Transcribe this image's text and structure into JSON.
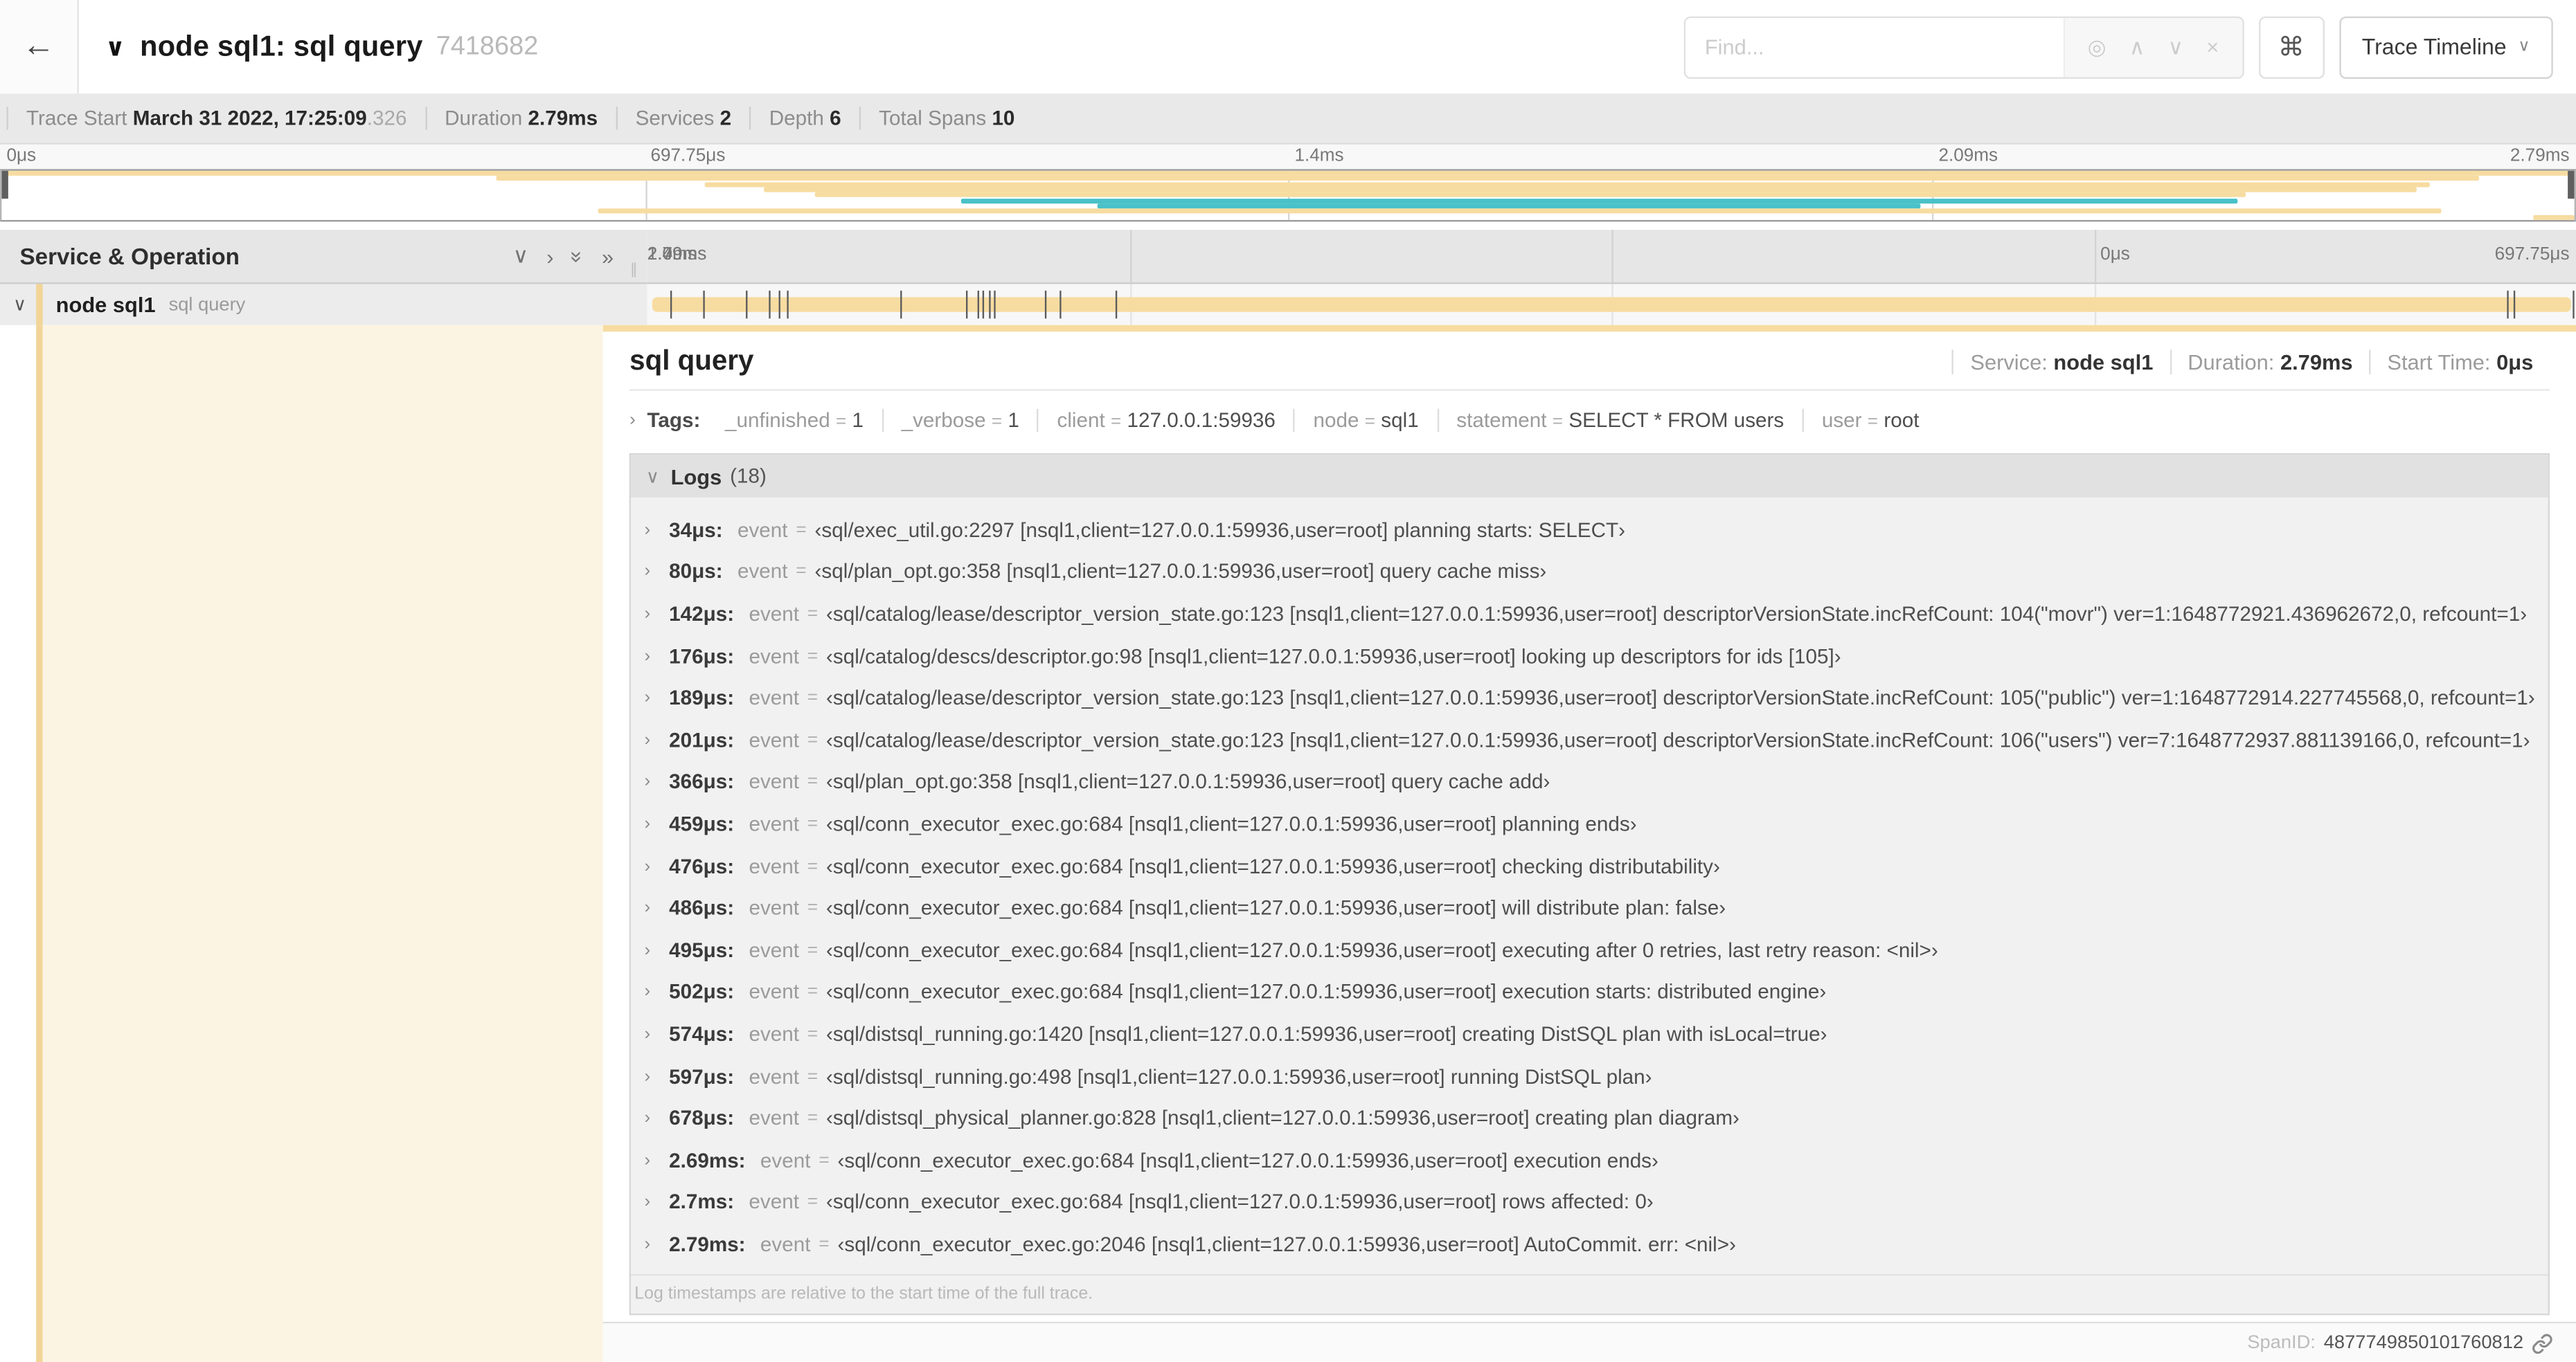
{
  "colors": {
    "tan": "#F7DCA1",
    "tanStripe": "#F2D597",
    "cream": "#FCF4E3",
    "teal": "#49C1C8"
  },
  "topbar": {
    "back_icon": "←",
    "collapse_caret": "∨",
    "title": "node sql1: sql query",
    "trace_id": "7418682",
    "find_placeholder": "Find...",
    "focus_icon": "◎",
    "prev_icon": "∧",
    "next_icon": "∨",
    "clear_icon": "×",
    "shortcut_icon": "⌘",
    "view_label": "Trace Timeline",
    "view_caret": "∨"
  },
  "trace_info": [
    {
      "label": "Trace Start",
      "value": "March 31 2022, 17:25:09",
      "suffix": ".326"
    },
    {
      "label": "Duration",
      "value": "2.79ms",
      "suffix": ""
    },
    {
      "label": "Services",
      "value": "2",
      "suffix": ""
    },
    {
      "label": "Depth",
      "value": "6",
      "suffix": ""
    },
    {
      "label": "Total Spans",
      "value": "10",
      "suffix": ""
    }
  ],
  "ticks": [
    "0μs",
    "697.75μs",
    "1.4ms",
    "2.09ms",
    "2.79ms"
  ],
  "minimap": {
    "rows": [
      {
        "start": 0,
        "end": 100,
        "color": "tan"
      },
      {
        "start": 19.2,
        "end": 96.3,
        "color": "tan"
      },
      {
        "start": 27.3,
        "end": 94.4,
        "color": "tan"
      },
      {
        "start": 29.6,
        "end": 93.9,
        "color": "tan"
      },
      {
        "start": 31.6,
        "end": 87.2,
        "color": "tan"
      },
      {
        "start": 37.3,
        "end": 86.9,
        "color": "teal"
      },
      {
        "start": 42.6,
        "end": 74.6,
        "color": "teal"
      },
      {
        "start": 23.2,
        "end": 94.8,
        "color": "tan"
      },
      {
        "start": 98.4,
        "end": 100,
        "color": "tan"
      }
    ]
  },
  "timeline_header": {
    "title": "Service & Operation",
    "collapse_one_icon": "∨",
    "expand_one_icon": "›",
    "collapse_all_icon": "»",
    "expand_all_icon": "»",
    "grip_icon": "∥"
  },
  "span_row": {
    "caret": "∨",
    "service": "node sql1",
    "operation": "sql query",
    "log_marker_pcts": [
      1.2,
      2.9,
      5.1,
      6.3,
      6.8,
      7.2,
      13.1,
      16.5,
      17.1,
      17.4,
      17.7,
      18.0,
      20.6,
      21.4,
      24.3,
      96.4,
      96.8,
      99.8
    ]
  },
  "detail": {
    "title": "sql query",
    "meta": [
      {
        "label": "Service:",
        "value": "node sql1"
      },
      {
        "label": "Duration:",
        "value": "2.79ms"
      },
      {
        "label": "Start Time:",
        "value": "0μs"
      }
    ],
    "tags_caret": "›",
    "tags_label": "Tags:",
    "tags": [
      {
        "key": "_unfinished",
        "value": "1"
      },
      {
        "key": "_verbose",
        "value": "1"
      },
      {
        "key": "client",
        "value": "127.0.0.1:59936"
      },
      {
        "key": "node",
        "value": "sql1"
      },
      {
        "key": "statement",
        "value": "SELECT * FROM users"
      },
      {
        "key": "user",
        "value": "root"
      }
    ],
    "logs_caret": "∨",
    "logs_label": "Logs",
    "logs_count": "(18)",
    "log_field_key": "event",
    "logs": [
      {
        "time": "34μs:",
        "key": "event",
        "value": "‹sql/exec_util.go:2297 [nsql1,client=127.0.0.1:59936,user=root] planning starts: SELECT›"
      },
      {
        "time": "80μs:",
        "key": "event",
        "value": "‹sql/plan_opt.go:358 [nsql1,client=127.0.0.1:59936,user=root] query cache miss›"
      },
      {
        "time": "142μs:",
        "key": "event",
        "value": "‹sql/catalog/lease/descriptor_version_state.go:123 [nsql1,client=127.0.0.1:59936,user=root] descriptorVersionState.incRefCount: 104(\"movr\") ver=1:1648772921.436962672,0, refcount=1›"
      },
      {
        "time": "176μs:",
        "key": "event",
        "value": "‹sql/catalog/descs/descriptor.go:98 [nsql1,client=127.0.0.1:59936,user=root] looking up descriptors for ids [105]›"
      },
      {
        "time": "189μs:",
        "key": "event",
        "value": "‹sql/catalog/lease/descriptor_version_state.go:123 [nsql1,client=127.0.0.1:59936,user=root] descriptorVersionState.incRefCount: 105(\"public\") ver=1:1648772914.227745568,0, refcount=1›"
      },
      {
        "time": "201μs:",
        "key": "event",
        "value": "‹sql/catalog/lease/descriptor_version_state.go:123 [nsql1,client=127.0.0.1:59936,user=root] descriptorVersionState.incRefCount: 106(\"users\") ver=7:1648772937.881139166,0, refcount=1›"
      },
      {
        "time": "366μs:",
        "key": "event",
        "value": "‹sql/plan_opt.go:358 [nsql1,client=127.0.0.1:59936,user=root] query cache add›"
      },
      {
        "time": "459μs:",
        "key": "event",
        "value": "‹sql/conn_executor_exec.go:684 [nsql1,client=127.0.0.1:59936,user=root] planning ends›"
      },
      {
        "time": "476μs:",
        "key": "event",
        "value": "‹sql/conn_executor_exec.go:684 [nsql1,client=127.0.0.1:59936,user=root] checking distributability›"
      },
      {
        "time": "486μs:",
        "key": "event",
        "value": "‹sql/conn_executor_exec.go:684 [nsql1,client=127.0.0.1:59936,user=root] will distribute plan: false›"
      },
      {
        "time": "495μs:",
        "key": "event",
        "value": "‹sql/conn_executor_exec.go:684 [nsql1,client=127.0.0.1:59936,user=root] executing after 0 retries, last retry reason: <nil>›"
      },
      {
        "time": "502μs:",
        "key": "event",
        "value": "‹sql/conn_executor_exec.go:684 [nsql1,client=127.0.0.1:59936,user=root] execution starts: distributed engine›"
      },
      {
        "time": "574μs:",
        "key": "event",
        "value": "‹sql/distsql_running.go:1420 [nsql1,client=127.0.0.1:59936,user=root] creating DistSQL plan with isLocal=true›"
      },
      {
        "time": "597μs:",
        "key": "event",
        "value": "‹sql/distsql_running.go:498 [nsql1,client=127.0.0.1:59936,user=root] running DistSQL plan›"
      },
      {
        "time": "678μs:",
        "key": "event",
        "value": "‹sql/distsql_physical_planner.go:828 [nsql1,client=127.0.0.1:59936,user=root] creating plan diagram›"
      },
      {
        "time": "2.69ms:",
        "key": "event",
        "value": "‹sql/conn_executor_exec.go:684 [nsql1,client=127.0.0.1:59936,user=root] execution ends›"
      },
      {
        "time": "2.7ms:",
        "key": "event",
        "value": "‹sql/conn_executor_exec.go:684 [nsql1,client=127.0.0.1:59936,user=root] rows affected: 0›"
      },
      {
        "time": "2.79ms:",
        "key": "event",
        "value": "‹sql/conn_executor_exec.go:2046 [nsql1,client=127.0.0.1:59936,user=root] AutoCommit. err: <nil>›"
      }
    ],
    "hint": "Log timestamps are relative to the start time of the full trace.",
    "span_id_label": "SpanID:",
    "span_id": "4877749850101760812"
  }
}
